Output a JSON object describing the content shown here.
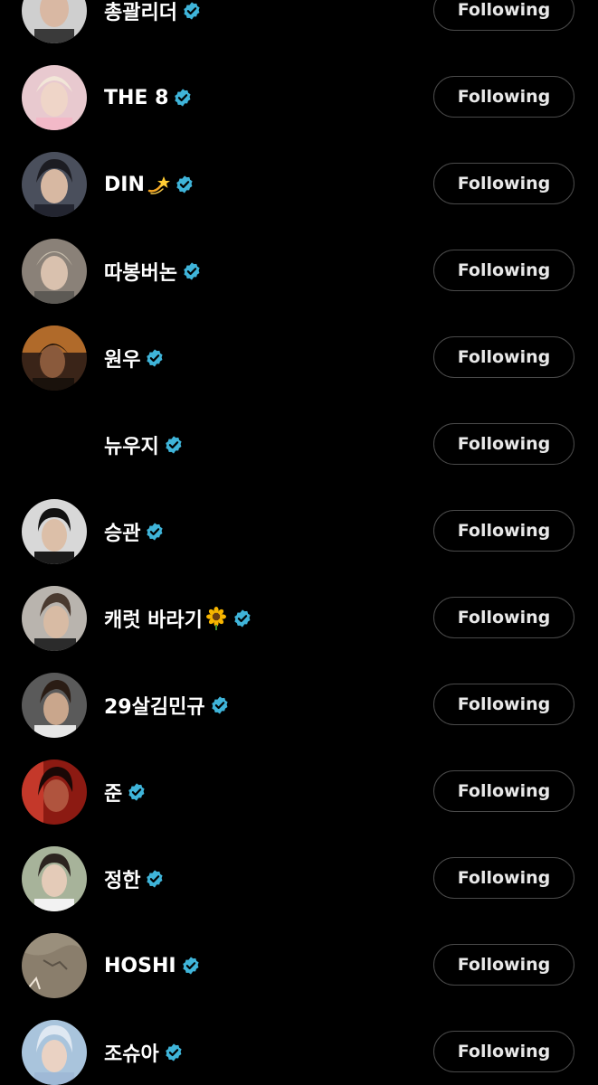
{
  "colors": {
    "background": "#000000",
    "verified_badge": "#3fb4d9",
    "button_border": "#4a4a4a",
    "button_text": "#e8e8e8"
  },
  "accounts": [
    {
      "name": "총괄리더",
      "emoji": "",
      "verified": true,
      "button_label": "Following",
      "avatar": "photo"
    },
    {
      "name": "THE 8",
      "emoji": "",
      "verified": true,
      "button_label": "Following",
      "avatar": "photo"
    },
    {
      "name": "DIN",
      "emoji": "dizzy",
      "verified": true,
      "button_label": "Following",
      "avatar": "photo"
    },
    {
      "name": "따봉버논",
      "emoji": "",
      "verified": true,
      "button_label": "Following",
      "avatar": "photo"
    },
    {
      "name": "원우",
      "emoji": "",
      "verified": true,
      "button_label": "Following",
      "avatar": "photo"
    },
    {
      "name": "뉴우지",
      "emoji": "",
      "verified": true,
      "button_label": "Following",
      "avatar": "none"
    },
    {
      "name": "승관",
      "emoji": "",
      "verified": true,
      "button_label": "Following",
      "avatar": "photo"
    },
    {
      "name": "캐럿 바라기",
      "emoji": "sunflower",
      "verified": true,
      "button_label": "Following",
      "avatar": "photo"
    },
    {
      "name": "29살김민규",
      "emoji": "",
      "verified": true,
      "button_label": "Following",
      "avatar": "photo"
    },
    {
      "name": "준",
      "emoji": "",
      "verified": true,
      "button_label": "Following",
      "avatar": "photo"
    },
    {
      "name": "정한",
      "emoji": "",
      "verified": true,
      "button_label": "Following",
      "avatar": "photo"
    },
    {
      "name": "HOSHI",
      "emoji": "",
      "verified": true,
      "button_label": "Following",
      "avatar": "photo"
    },
    {
      "name": "조슈아",
      "emoji": "",
      "verified": true,
      "button_label": "Following",
      "avatar": "photo"
    }
  ]
}
